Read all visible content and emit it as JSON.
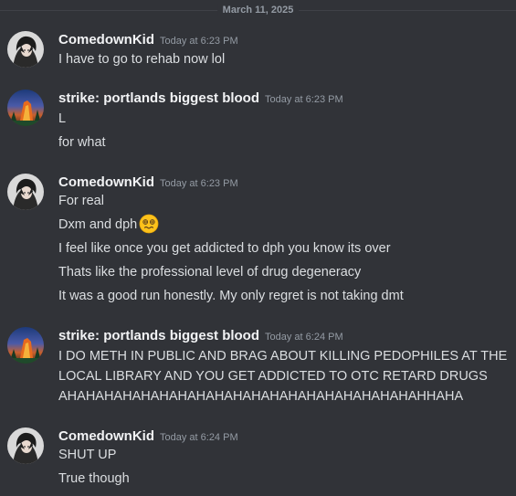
{
  "date_divider": "March 11, 2025",
  "messages": [
    {
      "username": "ComedownKid",
      "timestamp": "Today at 6:23 PM",
      "lines": [
        "I have to go to rehab now lol"
      ]
    },
    {
      "username": "strike: portlands biggest blood",
      "timestamp": "Today at 6:23 PM",
      "lines": [
        "L",
        "for what"
      ]
    },
    {
      "username": "ComedownKid",
      "timestamp": "Today at 6:23 PM",
      "lines": [
        "For real",
        "Dxm and dph",
        "I feel like once you get addicted to dph you know its over",
        "Thats like the professional level of drug degeneracy",
        "It was a good run honestly. My only regret is not taking dmt"
      ],
      "emoji": "woozy-face-emoji"
    },
    {
      "username": "strike: portlands biggest blood",
      "timestamp": "Today at 6:24 PM",
      "lines": [
        "I DO METH IN PUBLIC AND BRAG ABOUT KILLING PEDOPHILES AT THE LOCAL LIBRARY AND YOU GET ADDICTED TO OTC RETARD DRUGS AHAHAHAHAHAHAHAHAHAHAHAHAHAHAHAHAHAHAHAHHAHA"
      ]
    },
    {
      "username": "ComedownKid",
      "timestamp": "Today at 6:24 PM",
      "lines": [
        "SHUT UP",
        "True though"
      ]
    }
  ],
  "colors": {
    "background": "#313338",
    "username": "#f2f3f5",
    "text": "#dbdee1",
    "timestamp": "#949ba4"
  }
}
